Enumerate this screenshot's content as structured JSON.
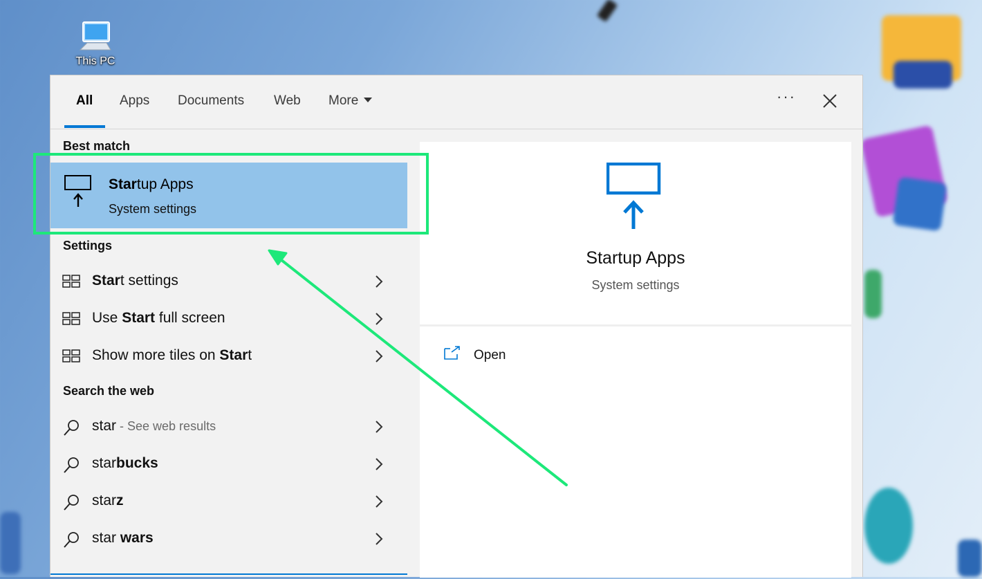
{
  "desktop": {
    "icon_label": "This PC",
    "icon": "monitor-icon"
  },
  "tabs": [
    {
      "label": "All",
      "active": true
    },
    {
      "label": "Apps"
    },
    {
      "label": "Documents"
    },
    {
      "label": "Web"
    },
    {
      "label": "More"
    }
  ],
  "toolbar": {
    "more_options": "···",
    "close_icon": "close-icon"
  },
  "sections": {
    "best_match": "Best match",
    "settings": "Settings",
    "web": "Search the web"
  },
  "best_match": {
    "title_bold": "Star",
    "title_rest": "tup Apps",
    "subtitle": "System settings",
    "icon": "startup-apps-icon"
  },
  "settings_items": [
    {
      "pre": "",
      "bold": "Star",
      "post": "t settings"
    },
    {
      "pre": "Use ",
      "bold": "Start",
      "post": " full screen"
    },
    {
      "pre": "Show more tiles on ",
      "bold": "Star",
      "post": "t"
    }
  ],
  "web_items": [
    {
      "pre": "star",
      "bold": "",
      "post": "",
      "suffix": " - See web results"
    },
    {
      "pre": "star",
      "bold": "bucks",
      "post": "",
      "suffix": ""
    },
    {
      "pre": "star",
      "bold": "z",
      "post": "",
      "suffix": ""
    },
    {
      "pre": "star ",
      "bold": "wars",
      "post": "",
      "suffix": ""
    }
  ],
  "preview": {
    "title": "Startup Apps",
    "subtitle": "System settings",
    "open_label": "Open",
    "open_icon": "open-external-icon"
  },
  "colors": {
    "accent": "#0078d4",
    "selection": "#92c3ea",
    "highlight_annotation": "#1de87a"
  }
}
